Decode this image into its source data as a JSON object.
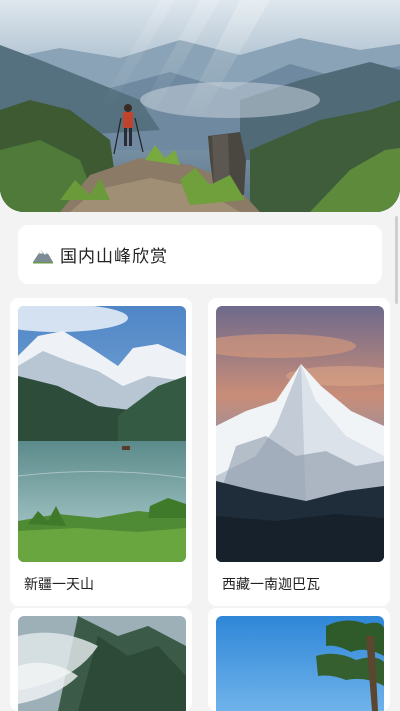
{
  "section": {
    "title": "国内山峰欣赏",
    "icon": "mountain-icon"
  },
  "cards": [
    {
      "caption": "新疆一天山"
    },
    {
      "caption": "西藏一南迦巴瓦"
    },
    {
      "caption": ""
    },
    {
      "caption": ""
    }
  ]
}
